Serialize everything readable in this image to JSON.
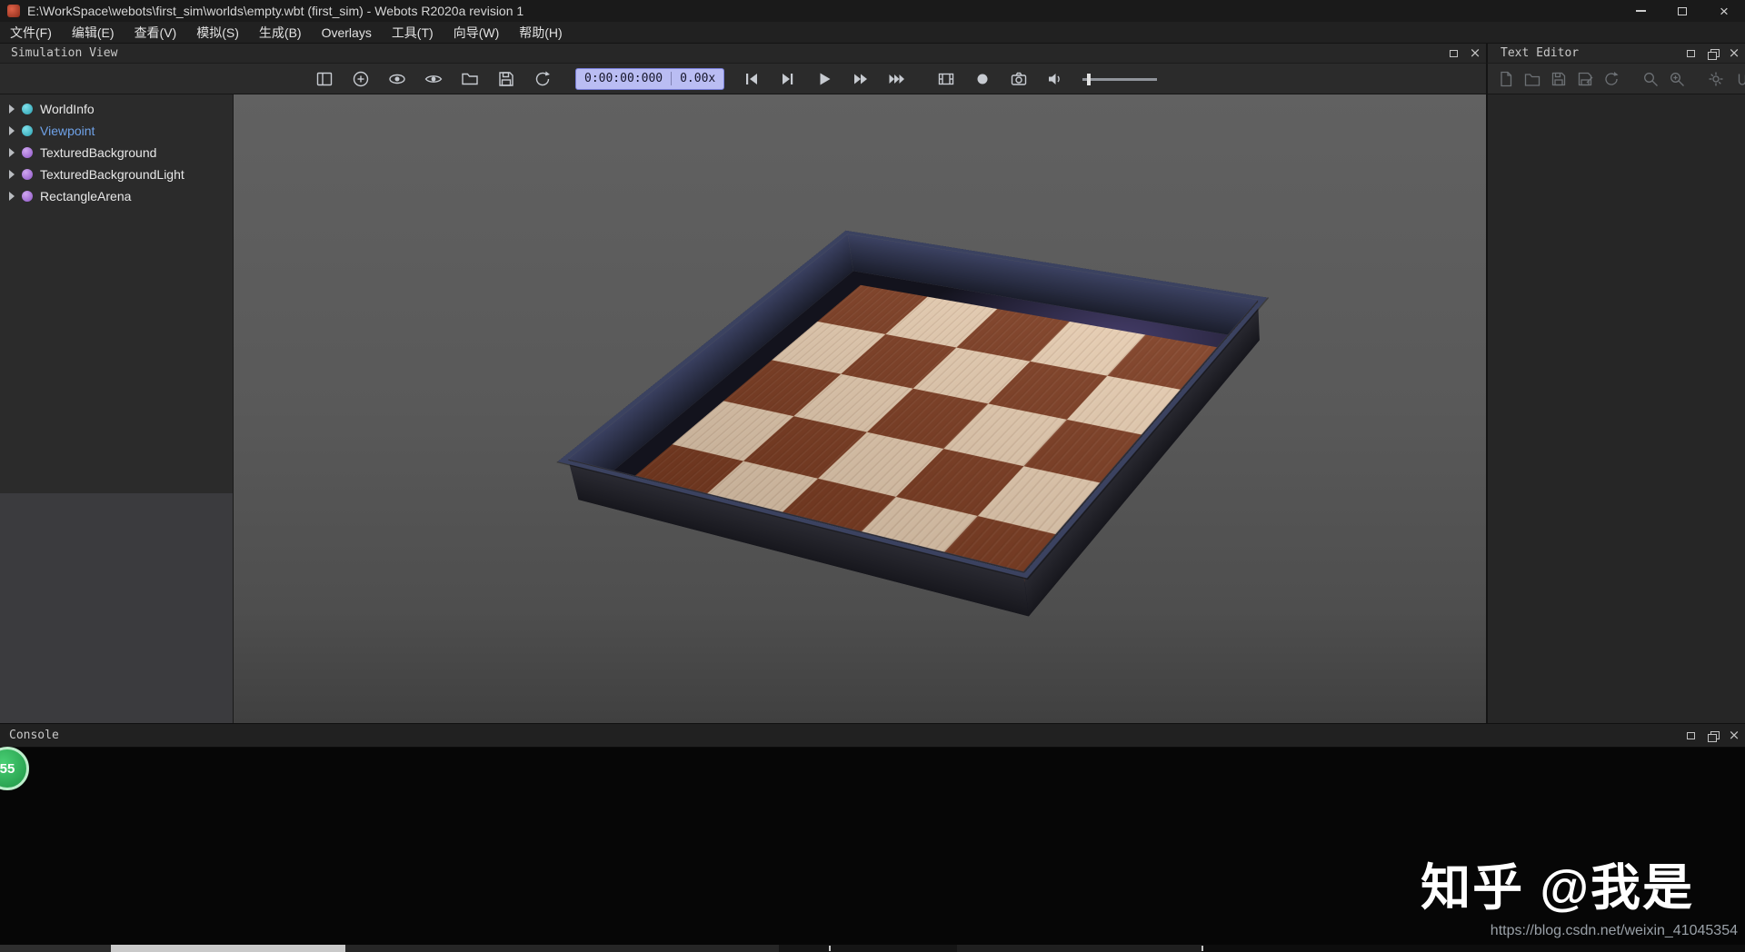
{
  "titlebar": {
    "title": "E:\\WorkSpace\\webots\\first_sim\\worlds\\empty.wbt (first_sim) - Webots R2020a revision 1",
    "close_glyph": "×"
  },
  "menubar": {
    "items": [
      "文件(F)",
      "编辑(E)",
      "查看(V)",
      "模拟(S)",
      "生成(B)",
      "Overlays",
      "工具(T)",
      "向导(W)",
      "帮助(H)"
    ]
  },
  "simulation_view": {
    "title": "Simulation View",
    "time": "0:00:00:000",
    "speed": "0.00x"
  },
  "scene_tree": {
    "items": [
      {
        "label": "WorldInfo",
        "icon": "teal-node-dot",
        "selected": false
      },
      {
        "label": "Viewpoint",
        "icon": "teal-node-dot",
        "selected": true
      },
      {
        "label": "TexturedBackground",
        "icon": "purple-node-dot",
        "selected": false
      },
      {
        "label": "TexturedBackgroundLight",
        "icon": "purple-node-dot",
        "selected": false
      },
      {
        "label": "RectangleArena",
        "icon": "purple-node-dot",
        "selected": false
      }
    ]
  },
  "text_editor": {
    "title": "Text Editor"
  },
  "console": {
    "title": "Console",
    "recording_badge": "55"
  },
  "overlays": {
    "watermark": "知乎 @我是",
    "source_url": "https://blog.csdn.net/weixin_41045354"
  },
  "colors": {
    "time_pill_bg": "#babdf3",
    "tree_dot_teal": "#39b8c8",
    "tree_dot_purple": "#a877dd",
    "selected_tree_item": "#6fa2e8",
    "arena_dark_tile": "#7e3d22",
    "arena_light_tile": "#e7cdb1",
    "arena_wall_rim": "#3b4260",
    "record_badge_green": "#2fae54",
    "viewport_gray": "#595959"
  }
}
